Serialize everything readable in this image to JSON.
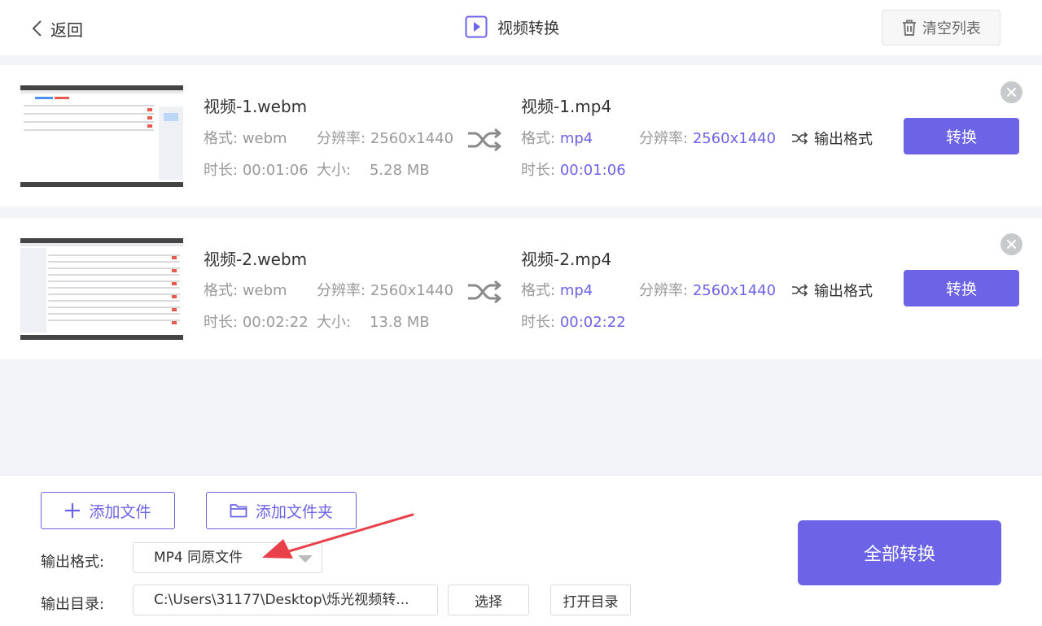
{
  "header": {
    "back_label": "返回",
    "title": "视频转换",
    "clear_label": "清空列表"
  },
  "files": [
    {
      "source_name": "视频-1.webm",
      "format_label": "格式:",
      "format": "webm",
      "resolution_label": "分辨率:",
      "resolution": "2560x1440",
      "duration_label": "时长:",
      "duration": "00:01:06",
      "size_label": "大小:",
      "size": "5.28 MB",
      "target_name": "视频-1.mp4",
      "target_format": "mp4",
      "target_resolution": "2560x1440",
      "target_duration": "00:01:06",
      "output_format_label": "输出格式",
      "convert_label": "转换"
    },
    {
      "source_name": "视频-2.webm",
      "format_label": "格式:",
      "format": "webm",
      "resolution_label": "分辨率:",
      "resolution": "2560x1440",
      "duration_label": "时长:",
      "duration": "00:02:22",
      "size_label": "大小:",
      "size": "13.8 MB",
      "target_name": "视频-2.mp4",
      "target_format": "mp4",
      "target_resolution": "2560x1440",
      "target_duration": "00:02:22",
      "output_format_label": "输出格式",
      "convert_label": "转换"
    }
  ],
  "bottom": {
    "add_file_label": "添加文件",
    "add_folder_label": "添加文件夹",
    "output_format_label": "输出格式:",
    "output_format_value": "MP4 同原文件",
    "output_dir_label": "输出目录:",
    "output_dir_value": "C:\\Users\\31177\\Desktop\\烁光视频转...",
    "choose_label": "选择",
    "open_dir_label": "打开目录",
    "convert_all_label": "全部转换"
  },
  "colors": {
    "accent": "#6c63e6",
    "annotation_arrow": "#e8414b"
  },
  "icons": [
    "chevron-left-icon",
    "play-video-icon",
    "trash-icon",
    "shuffle-icon",
    "close-icon",
    "plus-icon",
    "folder-icon",
    "caret-down-icon"
  ]
}
